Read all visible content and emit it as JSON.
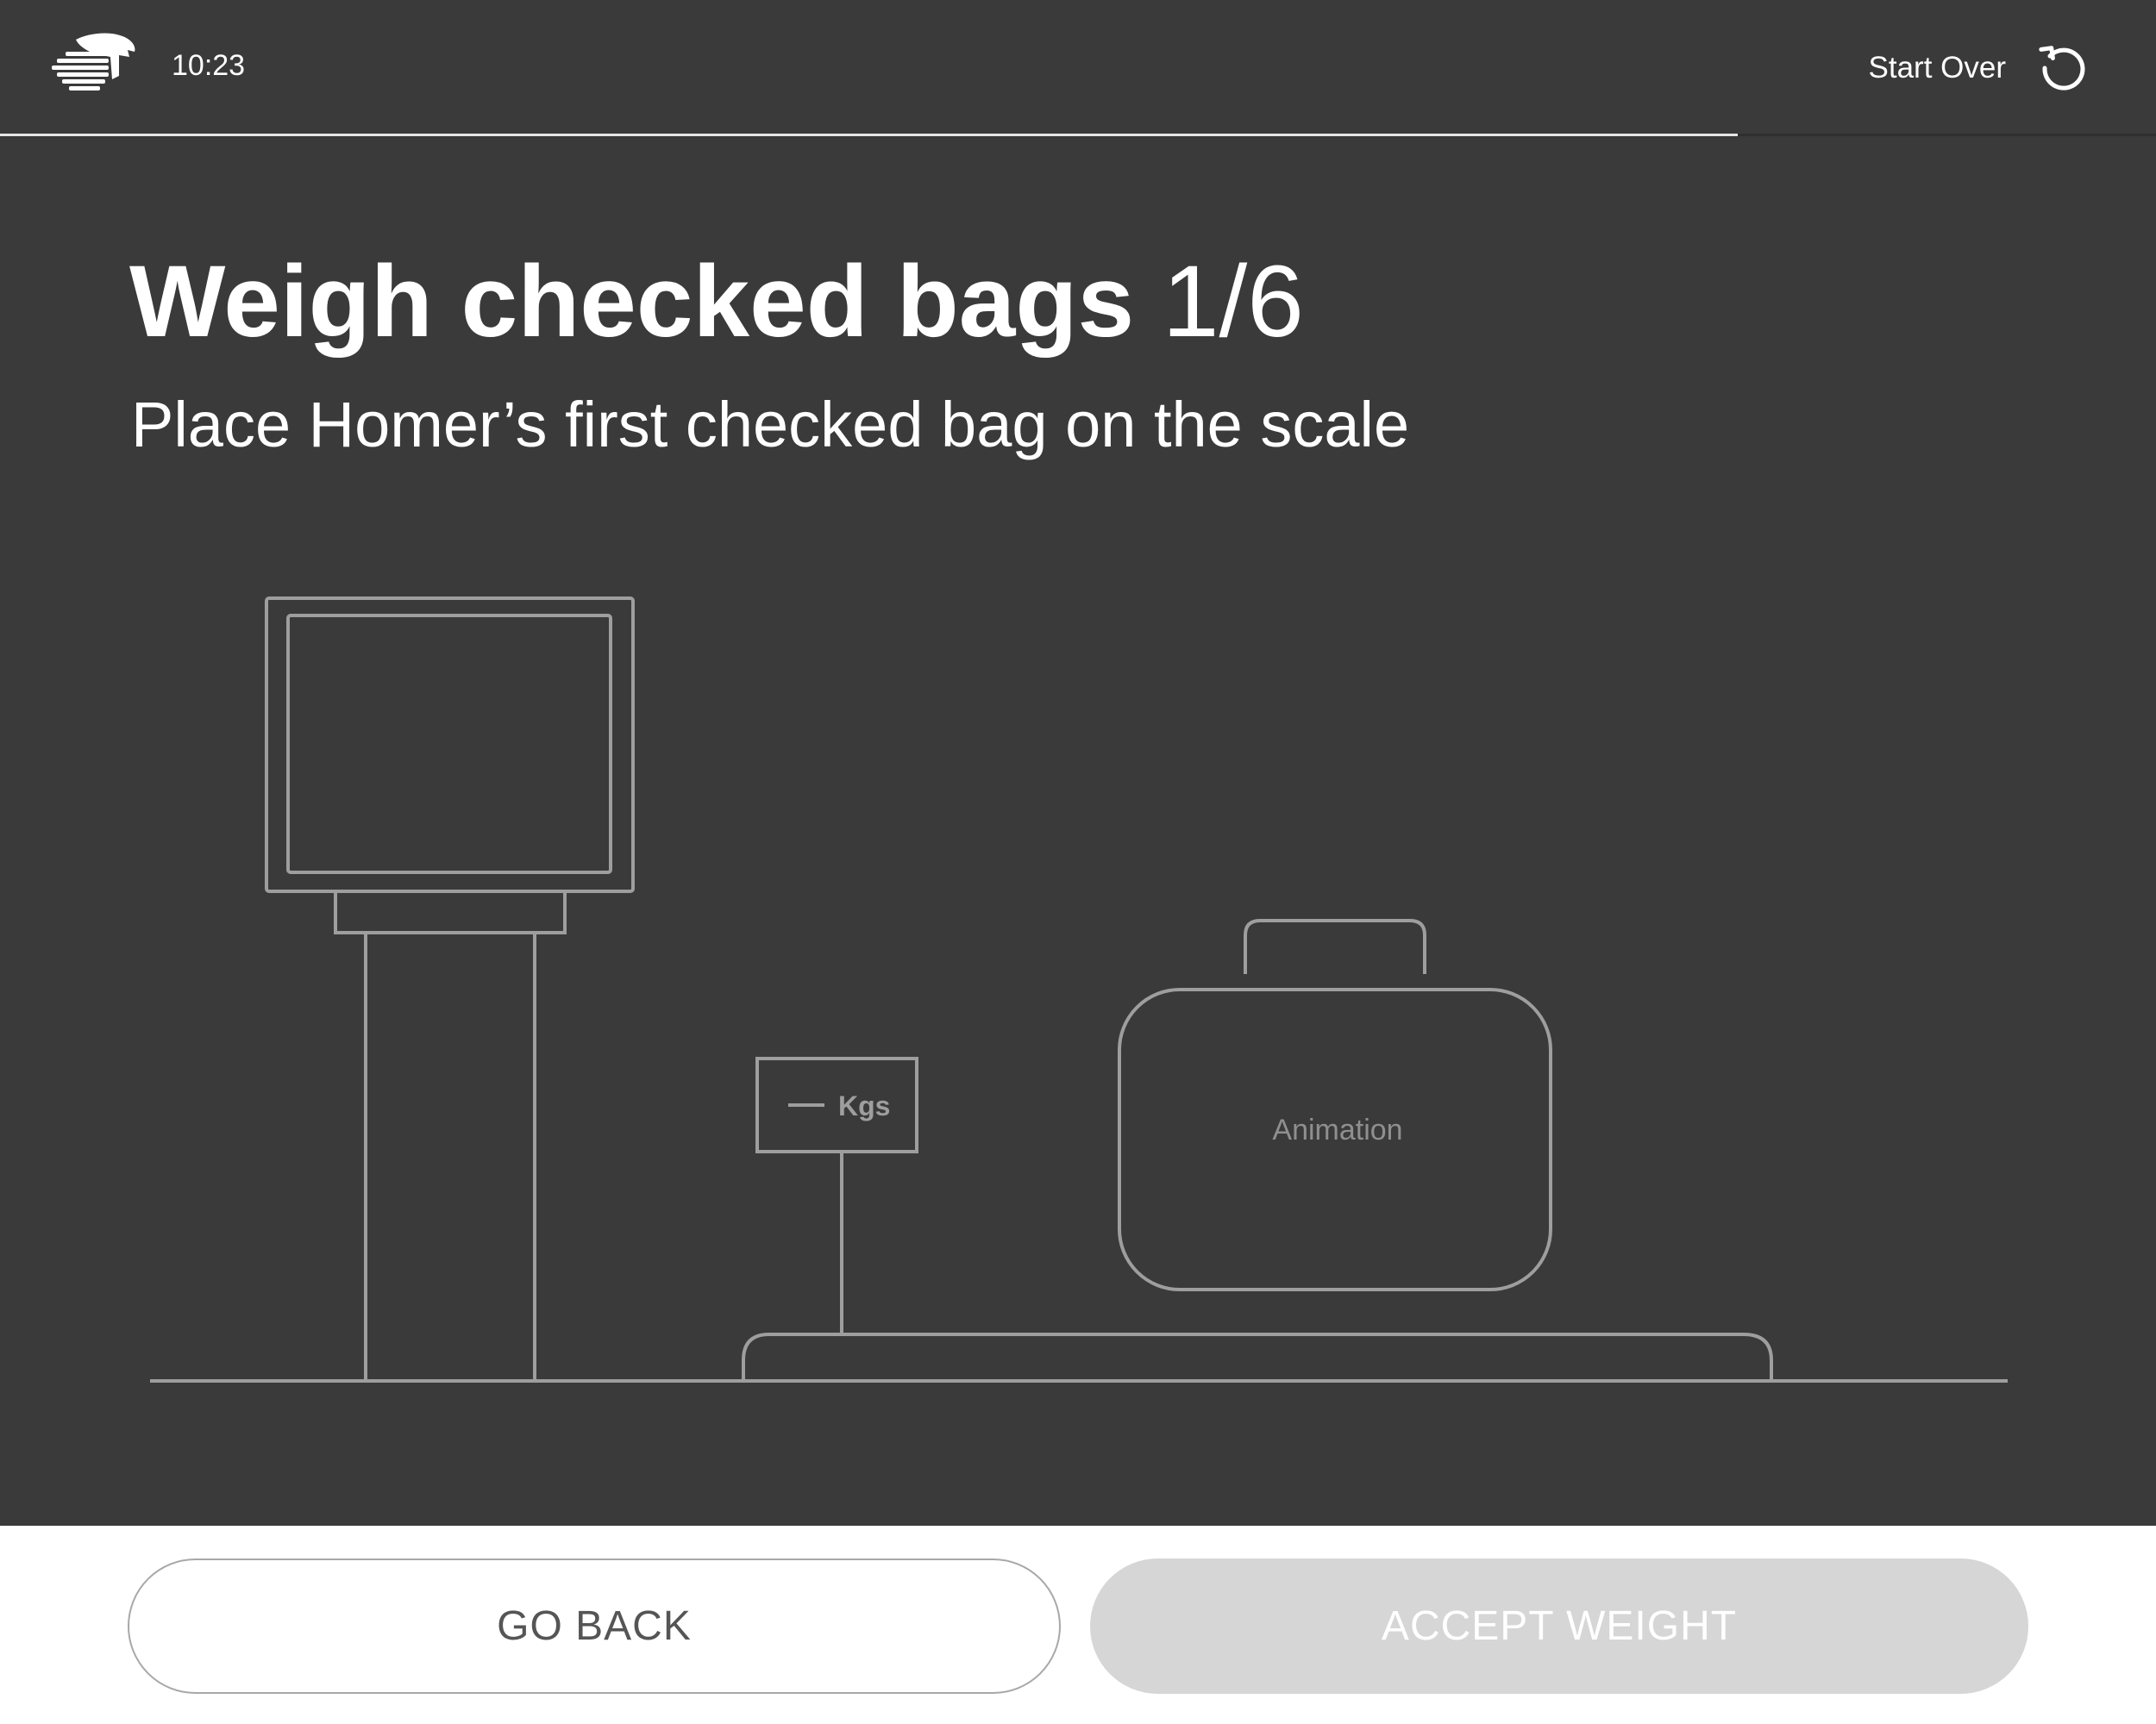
{
  "header": {
    "logo_icon": "eagle-logo-icon",
    "time": "10:23",
    "start_over_label": "Start Over",
    "start_over_icon": "restart-icon",
    "progress_fraction": 0.806
  },
  "main": {
    "title": "Weigh checked bags",
    "step": "1/6",
    "subtitle": "Place Homer’s first checked bag on the scale"
  },
  "illustration": {
    "scale_display_text": "Kgs",
    "animation_label": "Animation",
    "line_color": "#9e9e9e"
  },
  "footer": {
    "back_label": "GO BACK",
    "accept_label": "ACCEPT WEIGHT",
    "accept_disabled": true
  },
  "colors": {
    "background_dark": "#3a3a3a",
    "accept_disabled_bg": "#d6d6d6",
    "back_text": "#555555"
  }
}
